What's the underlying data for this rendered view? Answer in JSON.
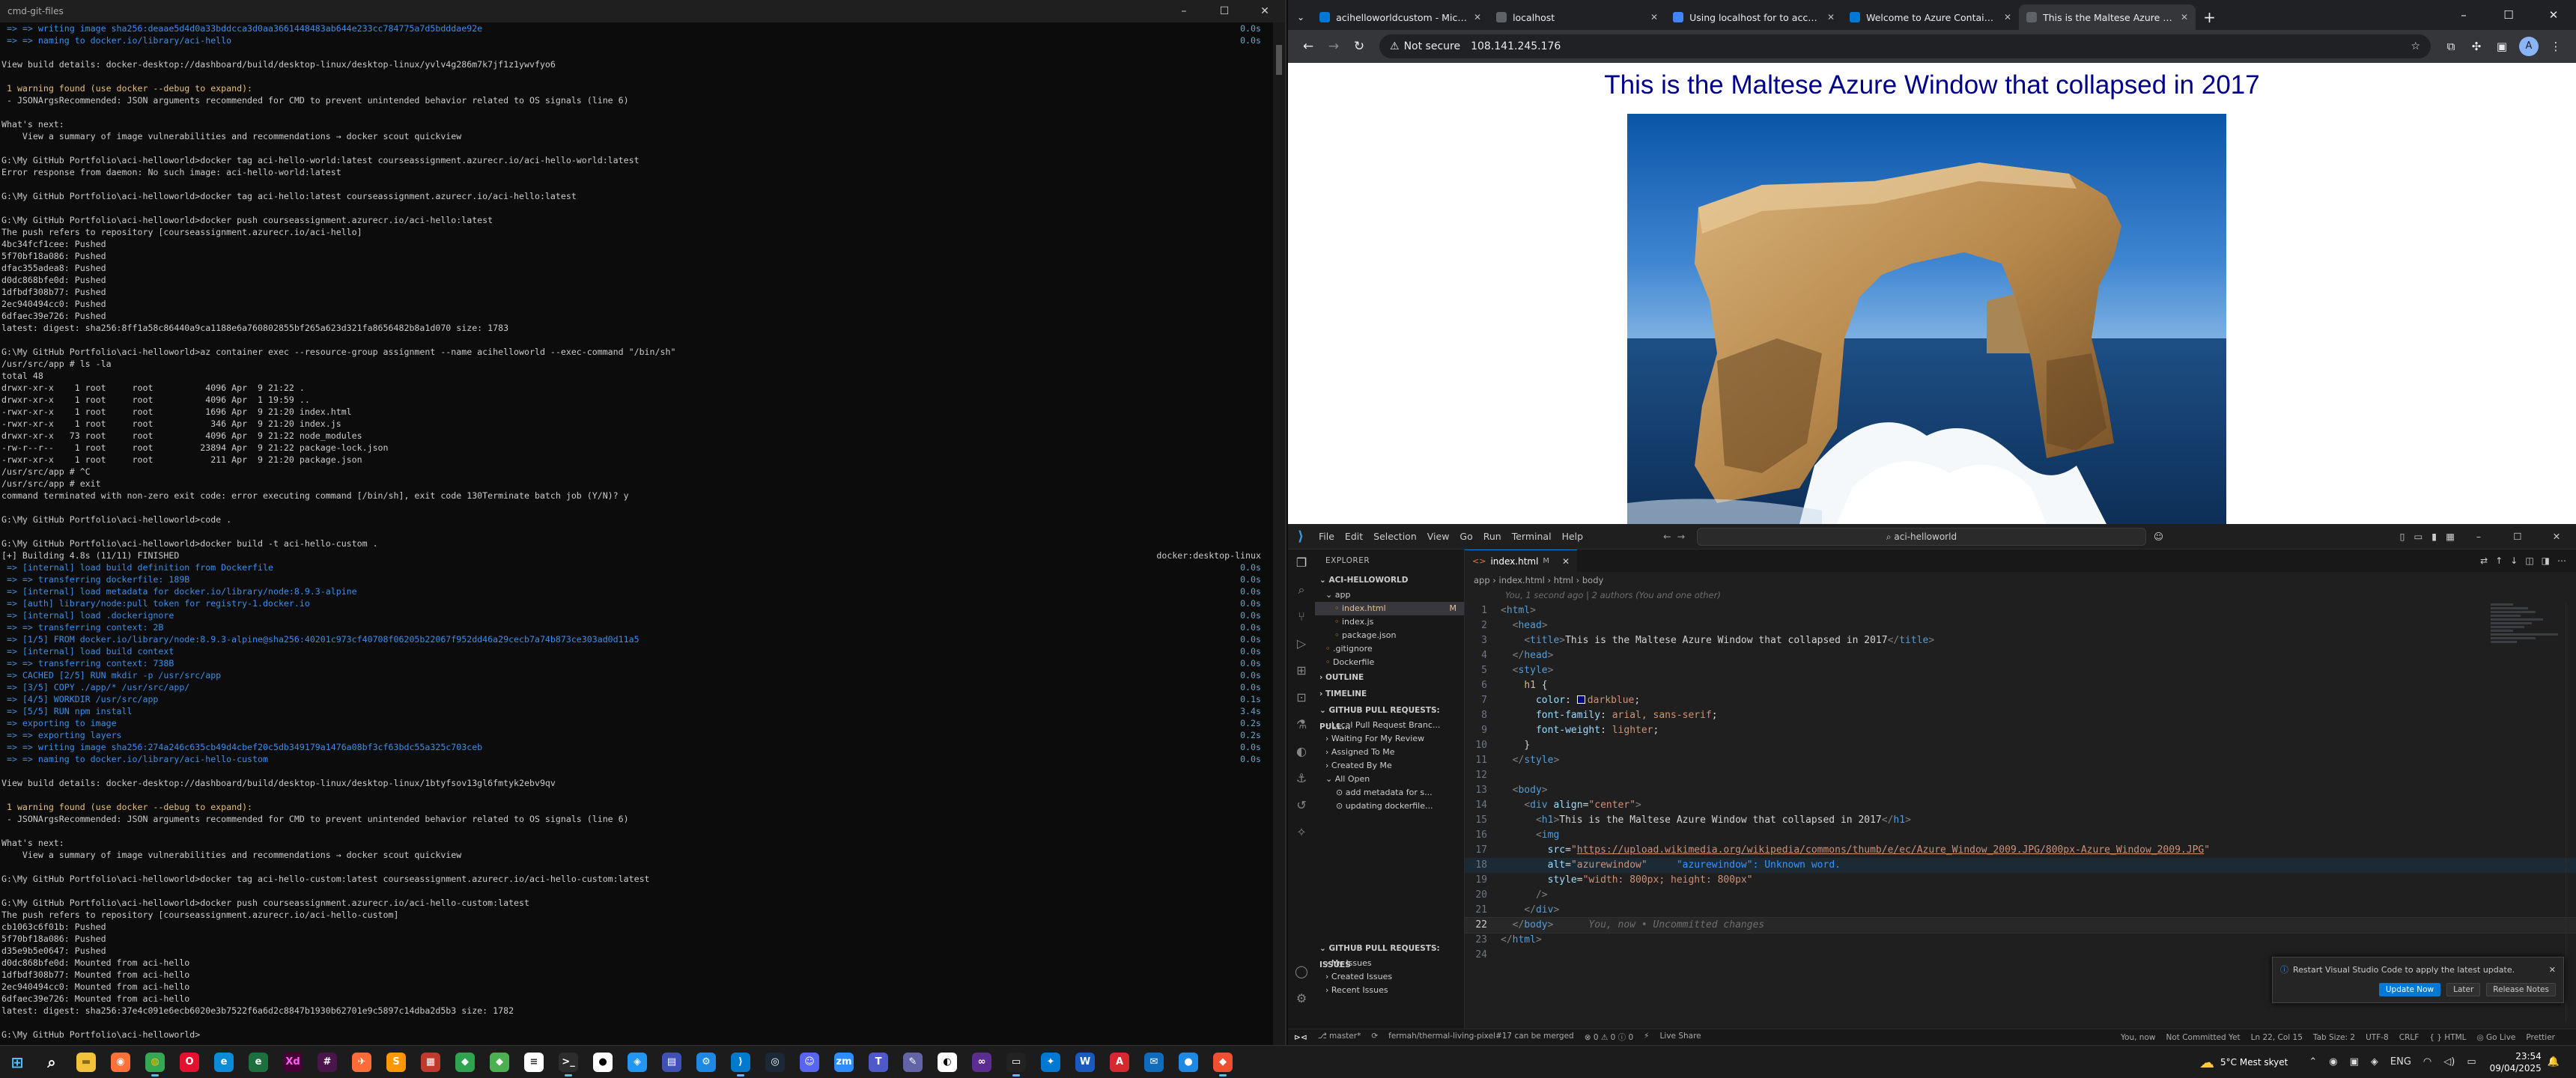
{
  "terminal": {
    "title": "cmd-git-files",
    "lines": [
      {
        "t": " => => writing image sha256:deaae5d4d0a33bddcca3d0aa3661448483ab644e233cc784775a7d5bdddae92e",
        "r": "0.0s",
        "c": "blue"
      },
      {
        "t": " => => naming to docker.io/library/aci-hello",
        "r": "0.0s",
        "c": "blue"
      },
      {
        "t": ""
      },
      {
        "t": "View build details: docker-desktop://dashboard/build/desktop-linux/desktop-linux/yvlv4g286m7k7jf1z1ywvfyo6"
      },
      {
        "t": ""
      },
      {
        "t": " 1 warning found (use docker --debug to expand):",
        "c": "yel"
      },
      {
        "t": " - JSONArgsRecommended: JSON arguments recommended for CMD to prevent unintended behavior related to OS signals (line 6)"
      },
      {
        "t": ""
      },
      {
        "t": "What's next:"
      },
      {
        "t": "    View a summary of image vulnerabilities and recommendations → docker scout quickview"
      },
      {
        "t": ""
      },
      {
        "t": "G:\\My GitHub Portfolio\\aci-helloworld>docker tag aci-hello-world:latest courseassignment.azurecr.io/aci-hello-world:latest"
      },
      {
        "t": "Error response from daemon: No such image: aci-hello-world:latest"
      },
      {
        "t": ""
      },
      {
        "t": "G:\\My GitHub Portfolio\\aci-helloworld>docker tag aci-hello:latest courseassignment.azurecr.io/aci-hello:latest"
      },
      {
        "t": ""
      },
      {
        "t": "G:\\My GitHub Portfolio\\aci-helloworld>docker push courseassignment.azurecr.io/aci-hello:latest"
      },
      {
        "t": "The push refers to repository [courseassignment.azurecr.io/aci-hello]"
      },
      {
        "t": "4bc34fcf1cee: Pushed"
      },
      {
        "t": "5f70bf18a086: Pushed"
      },
      {
        "t": "dfac355adea8: Pushed"
      },
      {
        "t": "d0dc868bfe0d: Pushed"
      },
      {
        "t": "1dfbdf308b77: Pushed"
      },
      {
        "t": "2ec940494cc0: Pushed"
      },
      {
        "t": "6dfaec39e726: Pushed"
      },
      {
        "t": "latest: digest: sha256:8ff1a58c86440a9ca1188e6a760802855bf265a623d321fa8656482b8a1d070 size: 1783"
      },
      {
        "t": ""
      },
      {
        "t": "G:\\My GitHub Portfolio\\aci-helloworld>az container exec --resource-group assignment --name acihelloworld --exec-command \"/bin/sh\""
      },
      {
        "t": "/usr/src/app # ls -la"
      },
      {
        "t": "total 48"
      },
      {
        "t": "drwxr-xr-x    1 root     root          4096 Apr  9 21:22 ."
      },
      {
        "t": "drwxr-xr-x    1 root     root          4096 Apr  1 19:59 .."
      },
      {
        "t": "-rwxr-xr-x    1 root     root          1696 Apr  9 21:20 index.html"
      },
      {
        "t": "-rwxr-xr-x    1 root     root           346 Apr  9 21:20 index.js"
      },
      {
        "t": "drwxr-xr-x   73 root     root          4096 Apr  9 21:22 node_modules"
      },
      {
        "t": "-rw-r--r--    1 root     root         23894 Apr  9 21:22 package-lock.json"
      },
      {
        "t": "-rwxr-xr-x    1 root     root           211 Apr  9 21:20 package.json"
      },
      {
        "t": "/usr/src/app # ^C"
      },
      {
        "t": "/usr/src/app # exit"
      },
      {
        "t": "command terminated with non-zero exit code: error executing command [/bin/sh], exit code 130Terminate batch job (Y/N)? y"
      },
      {
        "t": ""
      },
      {
        "t": "G:\\My GitHub Portfolio\\aci-helloworld>code ."
      },
      {
        "t": ""
      },
      {
        "t": "G:\\My GitHub Portfolio\\aci-helloworld>docker build -t aci-hello-custom ."
      },
      {
        "t": "[+] Building 4.8s (11/11) FINISHED",
        "r": "docker:desktop-linux",
        "rc": "plain"
      },
      {
        "t": " => [internal] load build definition from Dockerfile",
        "r": "0.0s",
        "c": "blue"
      },
      {
        "t": " => => transferring dockerfile: 189B",
        "r": "0.0s",
        "c": "blue"
      },
      {
        "t": " => [internal] load metadata for docker.io/library/node:8.9.3-alpine",
        "r": "0.0s",
        "c": "blue"
      },
      {
        "t": " => [auth] library/node:pull token for registry-1.docker.io",
        "r": "0.0s",
        "c": "blue"
      },
      {
        "t": " => [internal] load .dockerignore",
        "r": "0.0s",
        "c": "blue"
      },
      {
        "t": " => => transferring context: 2B",
        "r": "0.0s",
        "c": "blue"
      },
      {
        "t": " => [1/5] FROM docker.io/library/node:8.9.3-alpine@sha256:40201c973cf40708f06205b22067f952dd46a29cecb7a74b873ce303ad0d11a5",
        "r": "0.0s",
        "c": "blue"
      },
      {
        "t": " => [internal] load build context",
        "r": "0.0s",
        "c": "blue"
      },
      {
        "t": " => => transferring context: 738B",
        "r": "0.0s",
        "c": "blue"
      },
      {
        "t": " => CACHED [2/5] RUN mkdir -p /usr/src/app",
        "r": "0.0s",
        "c": "blue"
      },
      {
        "t": " => [3/5] COPY ./app/* /usr/src/app/",
        "r": "0.0s",
        "c": "blue"
      },
      {
        "t": " => [4/5] WORKDIR /usr/src/app",
        "r": "0.1s",
        "c": "blue"
      },
      {
        "t": " => [5/5] RUN npm install",
        "r": "3.4s",
        "c": "blue"
      },
      {
        "t": " => exporting to image",
        "r": "0.2s",
        "c": "blue"
      },
      {
        "t": " => => exporting layers",
        "r": "0.2s",
        "c": "blue"
      },
      {
        "t": " => => writing image sha256:274a246c635cb49d4cbef20c5db349179a1476a08bf3cf63bdc55a325c703ceb",
        "r": "0.0s",
        "c": "blue"
      },
      {
        "t": " => => naming to docker.io/library/aci-hello-custom",
        "r": "0.0s",
        "c": "blue"
      },
      {
        "t": ""
      },
      {
        "t": "View build details: docker-desktop://dashboard/build/desktop-linux/desktop-linux/1btyfsov13gl6fmtyk2ebv9qv"
      },
      {
        "t": ""
      },
      {
        "t": " 1 warning found (use docker --debug to expand):",
        "c": "yel"
      },
      {
        "t": " - JSONArgsRecommended: JSON arguments recommended for CMD to prevent unintended behavior related to OS signals (line 6)"
      },
      {
        "t": ""
      },
      {
        "t": "What's next:"
      },
      {
        "t": "    View a summary of image vulnerabilities and recommendations → docker scout quickview"
      },
      {
        "t": ""
      },
      {
        "t": "G:\\My GitHub Portfolio\\aci-helloworld>docker tag aci-hello-custom:latest courseassignment.azurecr.io/aci-hello-custom:latest"
      },
      {
        "t": ""
      },
      {
        "t": "G:\\My GitHub Portfolio\\aci-helloworld>docker push courseassignment.azurecr.io/aci-hello-custom:latest"
      },
      {
        "t": "The push refers to repository [courseassignment.azurecr.io/aci-hello-custom]"
      },
      {
        "t": "cb1063c6f01b: Pushed"
      },
      {
        "t": "5f70bf18a086: Pushed"
      },
      {
        "t": "d35e9b5e0647: Pushed"
      },
      {
        "t": "d0dc868bfe0d: Mounted from aci-hello"
      },
      {
        "t": "1dfbdf308b77: Mounted from aci-hello"
      },
      {
        "t": "2ec940494cc0: Mounted from aci-hello"
      },
      {
        "t": "6dfaec39e726: Mounted from aci-hello"
      },
      {
        "t": "latest: digest: sha256:37e4c091e6ecb6020e3b7522f6a6d2c8847b1930b62701e9c5897c14dba2d5b3 size: 1782"
      },
      {
        "t": ""
      },
      {
        "t": "G:\\My GitHub Portfolio\\aci-helloworld>"
      }
    ]
  },
  "browser": {
    "tabs": [
      {
        "label": "acihelloworldcustom - Microsof",
        "color": "#0078d4",
        "active": false
      },
      {
        "label": "localhost",
        "color": "#5f6368",
        "active": false
      },
      {
        "label": "Using localhost for to access m",
        "color": "#4285f4",
        "active": false
      },
      {
        "label": "Welcome to Azure Container In",
        "color": "#0078d4",
        "active": false
      },
      {
        "label": "This is the Maltese Azure Windo",
        "color": "#5f6368",
        "active": true
      }
    ],
    "not_secure": "Not secure",
    "url": "108.141.245.176",
    "page_heading": "This is the Maltese Azure Window that collapsed in 2017",
    "image_alt": "azurewindow",
    "profile_initial": "A"
  },
  "vscode": {
    "menu": [
      "File",
      "Edit",
      "Selection",
      "View",
      "Go",
      "Run",
      "Terminal",
      "Help"
    ],
    "search": "aci-helloworld",
    "explorer_title": "EXPLORER",
    "project": "ACI-HELLOWORLD",
    "tree": [
      {
        "label": "app",
        "indent": 14,
        "sel": false
      },
      {
        "label": "index.html",
        "indent": 26,
        "sel": true,
        "badge": "M"
      },
      {
        "label": "index.js",
        "indent": 26,
        "sel": false
      },
      {
        "label": "package.json",
        "indent": 26,
        "sel": false
      },
      {
        "label": ".gitignore",
        "indent": 14,
        "sel": false
      },
      {
        "label": "Dockerfile",
        "indent": 14,
        "sel": false
      }
    ],
    "sections": [
      "OUTLINE",
      "TIMELINE"
    ],
    "gh_title": "GITHUB PULL REQUESTS: PULL...",
    "gh_items": [
      "Local Pull Request Branc...",
      "Waiting For My Review",
      "Assigned To Me",
      "Created By Me",
      "All Open",
      "add metadata for s...",
      "updating dockerfile..."
    ],
    "issues_title": "GITHUB PULL REQUESTS: ISSUES",
    "issues_items": [
      "My Issues",
      "Created Issues",
      "Recent Issues"
    ],
    "tab": {
      "name": "index.html",
      "status": "M"
    },
    "breadcrumb": "app  ›  index.html  ›  html  ›  body",
    "blame": "You, 1 second ago | 2 authors (You and one other)",
    "cursor_line": 22,
    "ghost_text": "You, now • Uncommitted changes",
    "notification": {
      "message": "Restart Visual Studio Code to apply the latest update.",
      "buttons": [
        "Update Now",
        "Later",
        "Release Notes"
      ]
    },
    "status": {
      "left": [
        "⎇ master*",
        "⟳",
        "fermah/thermal-living-pixel#17 can be merged",
        "⊗ 0 ⚠ 0 ⓘ 0",
        "⚡",
        "Live Share"
      ],
      "right": [
        "You, now",
        "Not Committed Yet",
        "Ln 22, Col 15",
        "Tab Size: 2",
        "UTF-8",
        "CRLF",
        "{ } HTML",
        "◎ Go Live",
        "Prettier"
      ]
    }
  },
  "taskbar": {
    "apps": [
      {
        "n": "windows-start",
        "c": "#1c1c1c",
        "g": "⊞",
        "fg": "#4cc2ff"
      },
      {
        "n": "search",
        "c": "#1c1c1c",
        "g": "⌕",
        "fg": "#fff"
      },
      {
        "n": "file-explorer",
        "c": "#f3c13a",
        "g": "▬",
        "fg": "#8a6d1a"
      },
      {
        "n": "firefox",
        "c": "#ff7139",
        "g": "◉",
        "fg": "#fff"
      },
      {
        "n": "chrome",
        "c": "#34a853",
        "g": "◍",
        "fg": "#fbbc05",
        "act": true
      },
      {
        "n": "opera",
        "c": "#e4112f",
        "g": "O",
        "fg": "#fff"
      },
      {
        "n": "edge",
        "c": "#0c8cd8",
        "g": "e",
        "fg": "#fff"
      },
      {
        "n": "edge-dev",
        "c": "#1e6f3e",
        "g": "e",
        "fg": "#fff"
      },
      {
        "n": "xd",
        "c": "#470137",
        "g": "Xd",
        "fg": "#ff61f6"
      },
      {
        "n": "slack",
        "c": "#4a154b",
        "g": "#",
        "fg": "#fff"
      },
      {
        "n": "postman",
        "c": "#ff6c37",
        "g": "✈",
        "fg": "#fff"
      },
      {
        "n": "sublime",
        "c": "#ff9800",
        "g": "S",
        "fg": "#fff"
      },
      {
        "n": "db-tool",
        "c": "#c0392b",
        "g": "▦",
        "fg": "#fff"
      },
      {
        "n": "git-tool",
        "c": "#2ea44f",
        "g": "◆",
        "fg": "#fff"
      },
      {
        "n": "tool-1",
        "c": "#4caf50",
        "g": "◆",
        "fg": "#fff"
      },
      {
        "n": "notepad",
        "c": "#fff",
        "g": "≡",
        "fg": "#333"
      },
      {
        "n": "terminal",
        "c": "#2d2d2d",
        "g": ">_",
        "fg": "#fff",
        "act": true
      },
      {
        "n": "mail",
        "c": "#fff",
        "g": "●",
        "fg": "#000"
      },
      {
        "n": "photos",
        "c": "#2196f3",
        "g": "◈",
        "fg": "#fff"
      },
      {
        "n": "tool-2",
        "c": "#3f51b5",
        "g": "▤",
        "fg": "#fff"
      },
      {
        "n": "tool-3",
        "c": "#1e88e5",
        "g": "⚙",
        "fg": "#fff"
      },
      {
        "n": "vscode",
        "c": "#007acc",
        "g": "⟩",
        "fg": "#fff",
        "act": true
      },
      {
        "n": "steam",
        "c": "#1b2838",
        "g": "◎",
        "fg": "#fff"
      },
      {
        "n": "discord",
        "c": "#5865f2",
        "g": "☺",
        "fg": "#fff"
      },
      {
        "n": "zoom",
        "c": "#2d8cff",
        "g": "zm",
        "fg": "#fff"
      },
      {
        "n": "teams",
        "c": "#5059c9",
        "g": "T",
        "fg": "#fff"
      },
      {
        "n": "tool-4",
        "c": "#6264a7",
        "g": "✎",
        "fg": "#fff"
      },
      {
        "n": "github",
        "c": "#fff",
        "g": "◐",
        "fg": "#000"
      },
      {
        "n": "visual-studio",
        "c": "#5c2d91",
        "g": "∞",
        "fg": "#fff"
      },
      {
        "n": "cmd",
        "c": "#222",
        "g": "▭",
        "fg": "#fff",
        "act": true
      },
      {
        "n": "azure-data",
        "c": "#0078d4",
        "g": "✦",
        "fg": "#fff"
      },
      {
        "n": "word",
        "c": "#185abd",
        "g": "W",
        "fg": "#fff"
      },
      {
        "n": "acrobat",
        "c": "#d7282f",
        "g": "A",
        "fg": "#fff"
      },
      {
        "n": "mail-client",
        "c": "#0f6cbd",
        "g": "✉",
        "fg": "#fff"
      },
      {
        "n": "tool-5",
        "c": "#1e88e5",
        "g": "●",
        "fg": "#fff"
      },
      {
        "n": "git-bash",
        "c": "#f05032",
        "g": "◆",
        "fg": "#fff",
        "act": true
      }
    ],
    "weather": {
      "temp": "5°C",
      "desc": "Mest skyet"
    },
    "lang": "ENG",
    "time": "23:54",
    "date": "09/04/2025"
  }
}
